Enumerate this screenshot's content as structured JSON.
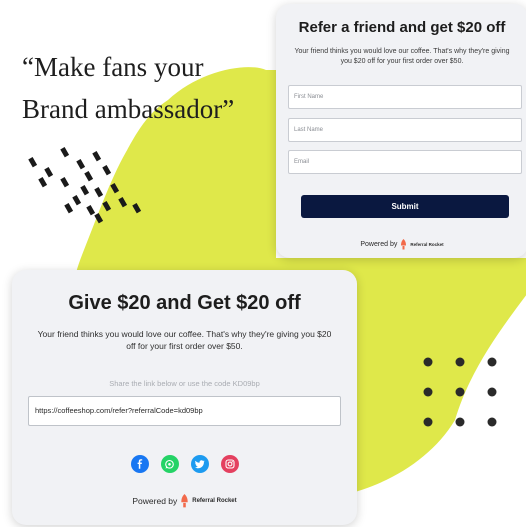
{
  "quote": {
    "line1": "“Make fans your",
    "line2": "Brand ambassador”"
  },
  "form_card": {
    "title": "Refer a friend and get $20 off",
    "subtitle": "Your friend thinks you would love our coffee. That's why they're giving you $20 off for your first order over $50.",
    "first_name_placeholder": "First Name",
    "last_name_placeholder": "Last Name",
    "email_placeholder": "Email",
    "submit_label": "Submit",
    "powered_by": "Powered by",
    "brand": "Referral Rocket"
  },
  "share_card": {
    "title": "Give $20 and Get $20 off",
    "subtitle": "Your friend thinks you would love our coffee. That's why they're giving you $20 off for your first order over $50.",
    "hint": "Share the link below or use the code KD09bp",
    "link": "https://coffeeshop.com/refer?referralCode=kd09bp",
    "social_icons": [
      "facebook-icon",
      "whatsapp-icon",
      "twitter-icon",
      "instagram-icon"
    ],
    "powered_by": "Powered by",
    "brand": "Referral Rocket"
  },
  "colors": {
    "accent_yellow": "#dfe84a",
    "button_navy": "#0a1840",
    "card_bg": "#f1f2f5",
    "rocket": "#f26a4b",
    "facebook": "#1877f2",
    "whatsapp": "#25d366",
    "twitter": "#1d9bf0",
    "instagram": "#e4405f"
  }
}
